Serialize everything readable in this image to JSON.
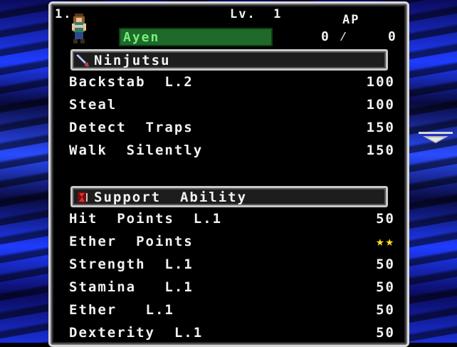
{
  "character": {
    "slot": "1.",
    "level": "Lv.  1",
    "ap_label": "AP",
    "ap_current": "0 ⁄",
    "ap_max": "0",
    "name": "Ayen"
  },
  "sections": [
    {
      "title": "Ninjutsu",
      "icon": "knife-icon",
      "items": [
        {
          "label": "Backstab  L.2",
          "value": "100"
        },
        {
          "label": "Steal",
          "value": "100"
        },
        {
          "label": "Detect  Traps",
          "value": "150"
        },
        {
          "label": "Walk  Silently",
          "value": "150"
        }
      ]
    },
    {
      "title": "Support  Ability",
      "icon": "support-ability-icon",
      "items": [
        {
          "label": "Hit  Points  L.1",
          "value": "50"
        },
        {
          "label": "Ether  Points",
          "value": "★★"
        },
        {
          "label": "Strength  L.1",
          "value": "50"
        },
        {
          "label": "Stamina   L.1",
          "value": "50"
        },
        {
          "label": "Ether   L.1",
          "value": "50"
        },
        {
          "label": "Dexterity  L.1",
          "value": "50"
        }
      ]
    }
  ],
  "colors": {
    "star": "#ffe21a",
    "name_box": "#1f6a2a",
    "name_text": "#76f07a"
  }
}
